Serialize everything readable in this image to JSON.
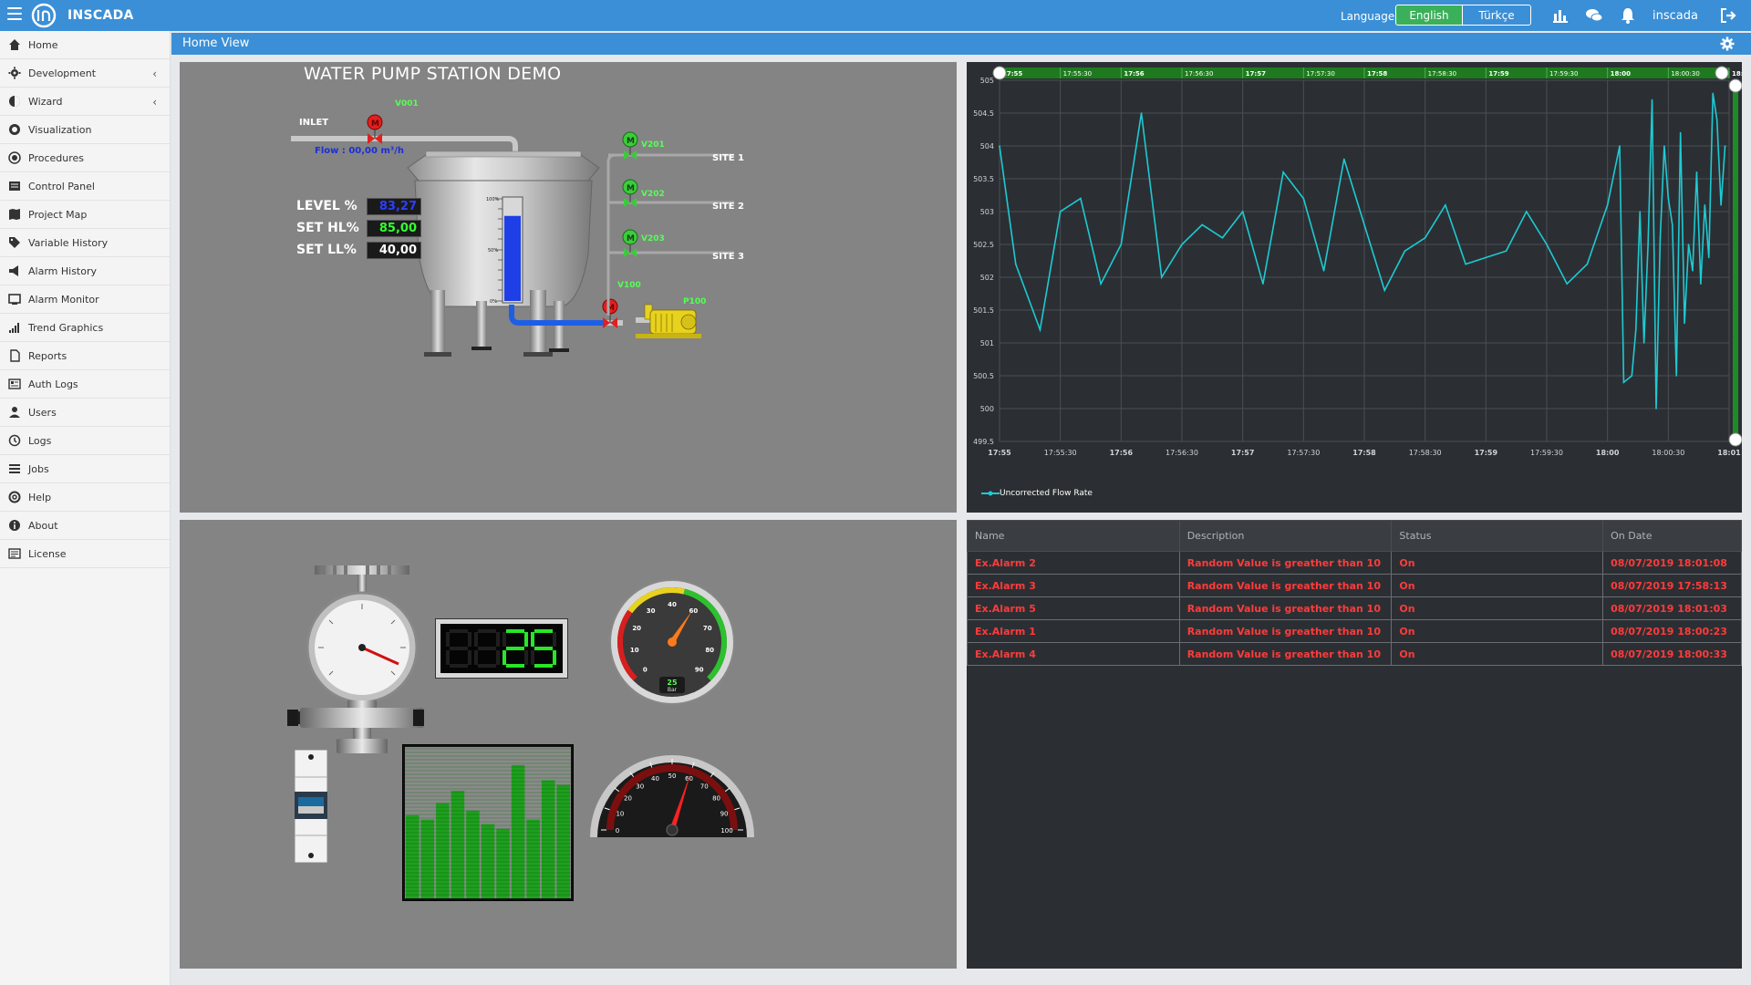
{
  "app": {
    "brand": "INSCADA",
    "language_label": "Language",
    "languages": [
      "English",
      "Türkçe"
    ],
    "username": "inscada"
  },
  "sidebar": {
    "items": [
      {
        "label": "Home",
        "icon": "home-icon"
      },
      {
        "label": "Development",
        "icon": "gear-icon",
        "chevron": "‹"
      },
      {
        "label": "Wizard",
        "icon": "magic-icon",
        "chevron": "‹"
      },
      {
        "label": "Visualization",
        "icon": "eye-icon"
      },
      {
        "label": "Procedures",
        "icon": "record-icon"
      },
      {
        "label": "Control Panel",
        "icon": "panel-icon"
      },
      {
        "label": "Project Map",
        "icon": "map-icon"
      },
      {
        "label": "Variable History",
        "icon": "tag-icon"
      },
      {
        "label": "Alarm History",
        "icon": "bullhorn-icon"
      },
      {
        "label": "Alarm Monitor",
        "icon": "monitor-icon"
      },
      {
        "label": "Trend Graphics",
        "icon": "signal-icon"
      },
      {
        "label": "Reports",
        "icon": "file-icon"
      },
      {
        "label": "Auth Logs",
        "icon": "card-icon"
      },
      {
        "label": "Users",
        "icon": "user-icon"
      },
      {
        "label": "Logs",
        "icon": "history-icon"
      },
      {
        "label": "Jobs",
        "icon": "list-icon"
      },
      {
        "label": "Help",
        "icon": "lifebuoy-icon"
      },
      {
        "label": "About",
        "icon": "info-icon"
      },
      {
        "label": "License",
        "icon": "license-icon"
      }
    ]
  },
  "page": {
    "title": "Home View"
  },
  "scada": {
    "title": "WATER PUMP STATION DEMO",
    "inlet": "INLET",
    "flow": "Flow : 00,00 m³/h",
    "valves": {
      "v001": "V001",
      "v201": "V201",
      "v202": "V202",
      "v203": "V203",
      "v100": "V100",
      "p100": "P100"
    },
    "sites": [
      "SITE 1",
      "SITE 2",
      "SITE 3"
    ],
    "tags": [
      {
        "label": "LEVEL %",
        "value": "83,27",
        "color": "#2a3fff"
      },
      {
        "label": "SET HL%",
        "value": "85,00",
        "color": "#33ff33"
      },
      {
        "label": "SET LL%",
        "value": "40,00",
        "color": "#ffffff"
      }
    ],
    "level": 83.27,
    "tank_ticks": [
      "100%",
      "50%",
      "0%"
    ],
    "colors": {
      "pipe": "#1e5ee6",
      "valve_open": "#3bcc3b",
      "valve_closed": "#e02020",
      "pump": "#e8d21e"
    }
  },
  "widgets": {
    "digital_display": "25",
    "gauge_ticks": [
      "0",
      "10",
      "20",
      "30",
      "40",
      "60",
      "70",
      "80",
      "90"
    ],
    "gauge_value": "25",
    "gauge_unit": "Bar",
    "speedo_ticks": [
      "0",
      "10",
      "20",
      "30",
      "40",
      "50",
      "60",
      "70",
      "80",
      "90",
      "100"
    ],
    "bar_levels": [
      0.55,
      0.52,
      0.63,
      0.71,
      0.58,
      0.49,
      0.46,
      0.88,
      0.52,
      0.78,
      0.75
    ]
  },
  "chart_data": {
    "type": "line",
    "title": "",
    "xlabel": "",
    "ylabel": "",
    "x_ticks": [
      "17:55",
      "17:55:30",
      "17:56",
      "17:56:30",
      "17:57",
      "17:57:30",
      "17:58",
      "17:58:30",
      "17:59",
      "17:59:30",
      "18:00",
      "18:00:30",
      "18:01"
    ],
    "y_ticks": [
      "505",
      "504.5",
      "504",
      "503.5",
      "503",
      "502.5",
      "502",
      "501.5",
      "501",
      "500.5",
      "500",
      "499.5"
    ],
    "ylim": [
      499.5,
      505
    ],
    "legend_position": "bottom-left",
    "grid": true,
    "series": [
      {
        "name": "Uncorrected Flow Rate",
        "color": "#1ecad3",
        "values": [
          [
            0,
            504.0
          ],
          [
            4,
            502.2
          ],
          [
            10,
            501.2
          ],
          [
            15,
            503.0
          ],
          [
            20,
            503.2
          ],
          [
            25,
            501.9
          ],
          [
            30,
            502.5
          ],
          [
            35,
            504.5
          ],
          [
            40,
            502.0
          ],
          [
            45,
            502.5
          ],
          [
            50,
            502.8
          ],
          [
            55,
            502.6
          ],
          [
            60,
            503.0
          ],
          [
            65,
            501.9
          ],
          [
            70,
            503.6
          ],
          [
            75,
            503.2
          ],
          [
            80,
            502.1
          ],
          [
            85,
            503.8
          ],
          [
            90,
            502.8
          ],
          [
            95,
            501.8
          ],
          [
            100,
            502.4
          ],
          [
            105,
            502.6
          ],
          [
            110,
            503.1
          ],
          [
            115,
            502.2
          ],
          [
            120,
            502.3
          ],
          [
            125,
            502.4
          ],
          [
            130,
            503.0
          ],
          [
            135,
            502.5
          ],
          [
            140,
            501.9
          ],
          [
            145,
            502.2
          ],
          [
            150,
            503.1
          ],
          [
            153,
            504.0
          ],
          [
            154,
            500.4
          ],
          [
            156,
            500.5
          ],
          [
            157,
            501.2
          ],
          [
            158,
            503.0
          ],
          [
            159,
            501.0
          ],
          [
            160,
            502.5
          ],
          [
            161,
            504.7
          ],
          [
            162,
            500.0
          ],
          [
            163,
            502.6
          ],
          [
            164,
            504.0
          ],
          [
            165,
            503.2
          ],
          [
            166,
            502.8
          ],
          [
            167,
            500.5
          ],
          [
            168,
            504.2
          ],
          [
            169,
            501.3
          ],
          [
            170,
            502.5
          ],
          [
            171,
            502.1
          ],
          [
            172,
            503.6
          ],
          [
            173,
            501.9
          ],
          [
            174,
            503.1
          ],
          [
            175,
            502.3
          ],
          [
            176,
            504.8
          ],
          [
            177,
            504.4
          ],
          [
            178,
            503.1
          ],
          [
            179,
            504.0
          ]
        ]
      }
    ]
  },
  "alarms": {
    "columns": [
      "Name",
      "Description",
      "Status",
      "On Date"
    ],
    "rows": [
      [
        "Ex.Alarm 2",
        "Random Value is greather than 10",
        "On",
        "08/07/2019 18:01:08"
      ],
      [
        "Ex.Alarm 3",
        "Random Value is greather than 10",
        "On",
        "08/07/2019 17:58:13"
      ],
      [
        "Ex.Alarm 5",
        "Random Value is greather than 10",
        "On",
        "08/07/2019 18:01:03"
      ],
      [
        "Ex.Alarm 1",
        "Random Value is greather than 10",
        "On",
        "08/07/2019 18:00:23"
      ],
      [
        "Ex.Alarm 4",
        "Random Value is greather than 10",
        "On",
        "08/07/2019 18:00:33"
      ]
    ]
  }
}
